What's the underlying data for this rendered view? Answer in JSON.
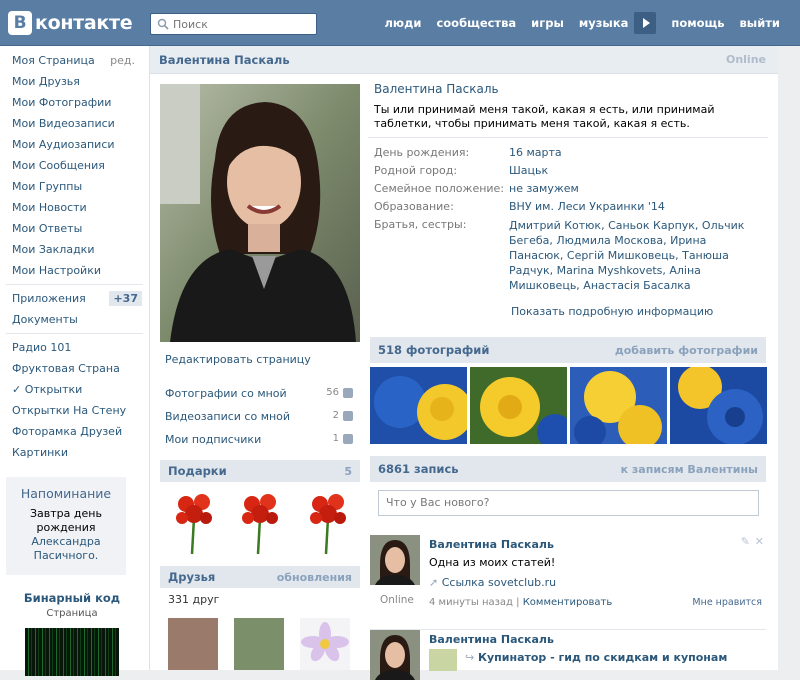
{
  "header": {
    "logo_letter": "В",
    "logo_text": "контакте",
    "search_placeholder": "Поиск",
    "nav": [
      "люди",
      "сообщества",
      "игры",
      "музыка",
      "помощь",
      "выйти"
    ]
  },
  "sidebar": {
    "items": [
      {
        "label": "Моя Страница",
        "extra": "ред."
      },
      {
        "label": "Мои Друзья"
      },
      {
        "label": "Мои Фотографии"
      },
      {
        "label": "Мои Видеозаписи"
      },
      {
        "label": "Мои Аудиозаписи"
      },
      {
        "label": "Мои Сообщения"
      },
      {
        "label": "Мои Группы"
      },
      {
        "label": "Мои Новости"
      },
      {
        "label": "Мои Ответы"
      },
      {
        "label": "Мои Закладки"
      },
      {
        "label": "Мои Настройки"
      }
    ],
    "apps": [
      {
        "label": "Приложения",
        "count": "+37"
      },
      {
        "label": "Документы"
      }
    ],
    "extras": [
      "Радио 101",
      "Фруктовая Страна",
      "Открытки",
      "Открытки На Стену",
      "Фоторамка Друзей",
      "Картинки"
    ],
    "check_mark": "✓",
    "reminder": {
      "title": "Напоминание",
      "pre": "Завтра",
      "bold": "день рождения",
      "name": "Александра Пасичного."
    },
    "promo": {
      "title": "Бинарный код",
      "subtitle": "Страница"
    }
  },
  "profile": {
    "header_name": "Валентина Паскаль",
    "online": "Online",
    "edit_page": "Редактировать страницу",
    "counters": [
      {
        "label": "Фотографии со мной",
        "value": "56"
      },
      {
        "label": "Видеозаписи со мной",
        "value": "2"
      },
      {
        "label": "Мои подписчики",
        "value": "1"
      }
    ],
    "gifts": {
      "title": "Подарки",
      "count": "5"
    },
    "friends": {
      "title": "Друзья",
      "action": "обновления",
      "count": "331 друг"
    },
    "name": "Валентина Паскаль",
    "status": "Ты или принимай меня такой, какая я есть, или принимай таблетки, чтобы принимать меня такой, какая я есть.",
    "details": [
      {
        "key": "День рождения:",
        "value": "16 марта"
      },
      {
        "key": "Родной город:",
        "value": "Шацьк"
      },
      {
        "key": "Семейное положение:",
        "value": "не замужем"
      },
      {
        "key": "Образование:",
        "value": "ВНУ им. Леси Украинки '14"
      },
      {
        "key": "Братья, сестры:",
        "value": "Дмитрий Котюк, Саньок Карпук, Ольчик Бегеба, Людмила Москова, Ирина Панасюк, Сергій Мишковець, Танюша Радчук, Marina Myshkovets, Аліна Мишковець, Анастасія Басалка"
      }
    ],
    "more_info": "Показать подробную информацию",
    "photos": {
      "title": "518 фотографий",
      "action": "добавить фотографии"
    },
    "wall": {
      "title": "6861 запись",
      "action": "к записям Валентины",
      "composer_placeholder": "Что у Вас нового?"
    },
    "posts": [
      {
        "author": "Валентина Паскаль",
        "text": "Одна из моих статей!",
        "link": "Ссылка sovetclub.ru",
        "time": "4 минуты назад",
        "comment": "Комментировать",
        "like": "Мне нравится",
        "online": "Online"
      },
      {
        "author": "Валентина Паскаль",
        "text": "Купинатор - гид по скидкам и купонам"
      }
    ]
  }
}
